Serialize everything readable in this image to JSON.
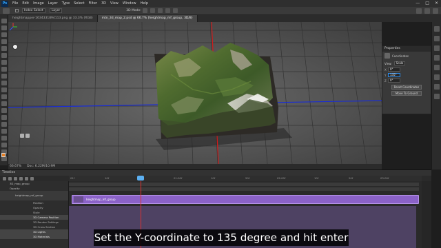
{
  "app": {
    "logo": "Ps"
  },
  "menu": [
    "File",
    "Edit",
    "Image",
    "Layer",
    "Type",
    "Select",
    "Filter",
    "3D",
    "View",
    "Window",
    "Help"
  ],
  "window_controls": [
    "—",
    "□",
    "✕"
  ],
  "options_bar": {
    "field1": "Index Select",
    "field2": "Layer",
    "mode_label": "3D Mode:"
  },
  "tabs": [
    {
      "label": "heightmapper-1634331894113.png @ 33.3% (RGB)",
      "active": false
    },
    {
      "label": "mtn_3d_map_2.psd @ 66.7% (heightmap_mf_group, 3D/8)",
      "active": true
    }
  ],
  "status": {
    "zoom": "66.67%",
    "doc": "Doc: 6.22M/10.9M"
  },
  "properties": {
    "title": "Properties",
    "mode_label": "Coordinates",
    "view_label": "View:",
    "view_value": "Scale",
    "coords": [
      {
        "axis": "X",
        "value": "0°"
      },
      {
        "axis": "Y",
        "value": "135°"
      },
      {
        "axis": "Z",
        "value": "0°"
      }
    ],
    "reset_button": "Reset Coordinates",
    "move_button": "Move To Ground"
  },
  "timeline": {
    "title": "Timeline",
    "ruler": [
      "01f",
      "10f",
      "20f",
      "01:00f",
      "10f",
      "20f",
      "02:00f",
      "10f",
      "20f",
      "03:00f"
    ],
    "clip_label": "heightmap_mf_group",
    "layers": [
      {
        "label": "3D_map_group",
        "type": "folder"
      },
      {
        "label": "Opacity",
        "type": "plain"
      },
      {
        "label": "heightmap_mf_group",
        "type": "main"
      },
      {
        "label": "Position",
        "type": "sub"
      },
      {
        "label": "Opacity",
        "type": "sub"
      },
      {
        "label": "Style",
        "type": "sub"
      },
      {
        "label": "3D Camera Position",
        "type": "sub-dark"
      },
      {
        "label": "3D Render Settings",
        "type": "sub"
      },
      {
        "label": "3D Cross Section",
        "type": "sub"
      },
      {
        "label": "3D Lights",
        "type": "sub-dark"
      },
      {
        "label": "3D Materials",
        "type": "sub-dark"
      }
    ]
  },
  "subtitle": "Set the Y-coordinate to 135 degree and hit enter"
}
